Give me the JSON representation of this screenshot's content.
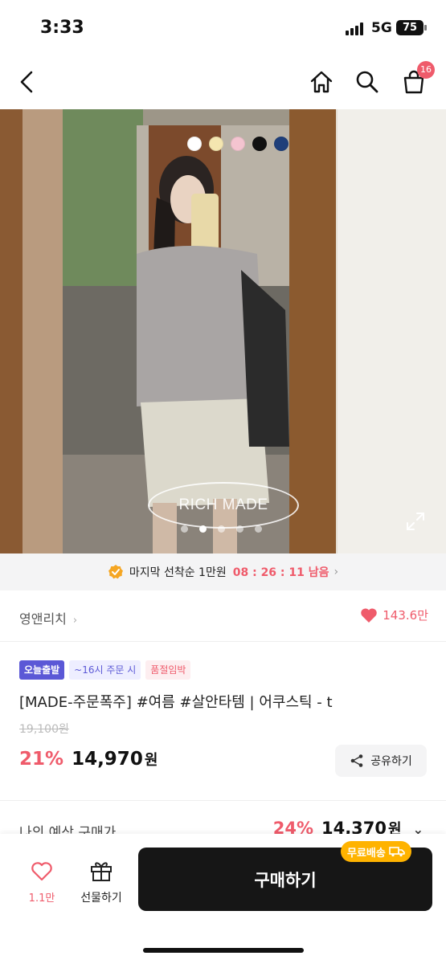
{
  "status_bar": {
    "time": "3:33",
    "network": "5G",
    "battery": "75"
  },
  "nav": {
    "cart_count": "16"
  },
  "product_image": {
    "color_options": [
      "#ffffff",
      "#f4e6b0",
      "#f4c4d0",
      "#111111",
      "#1f3f7a"
    ],
    "watermark": "RICH MADE",
    "image_count": 5,
    "active_index": 1
  },
  "timer_banner": {
    "label": "마지막 선착순 1만원",
    "countdown": "08 : 26 : 11 남음"
  },
  "brand": {
    "name": "영앤리치",
    "likes": "143.6만"
  },
  "product": {
    "tags": [
      "오늘출발",
      "~16시 주문 시",
      "품절임박"
    ],
    "title": "[MADE-주문폭주] #여름 #살안타템 | 어쿠스틱 - t",
    "original_price": "19,100원",
    "discount": "21%",
    "price": "14,970",
    "price_unit": "원",
    "share_label": "공유하기"
  },
  "estimate": {
    "label": "나의 예상 구매가",
    "discount": "24%",
    "price": "14,370",
    "unit": "원"
  },
  "bottom_bar": {
    "like_count": "1.1만",
    "gift_label": "선물하기",
    "buy_label": "구매하기",
    "free_shipping": "무료배송"
  },
  "colors": {
    "accent": "#ef5b6b",
    "tag_purple": "#5b58d6",
    "free_ship": "#ffb300"
  }
}
